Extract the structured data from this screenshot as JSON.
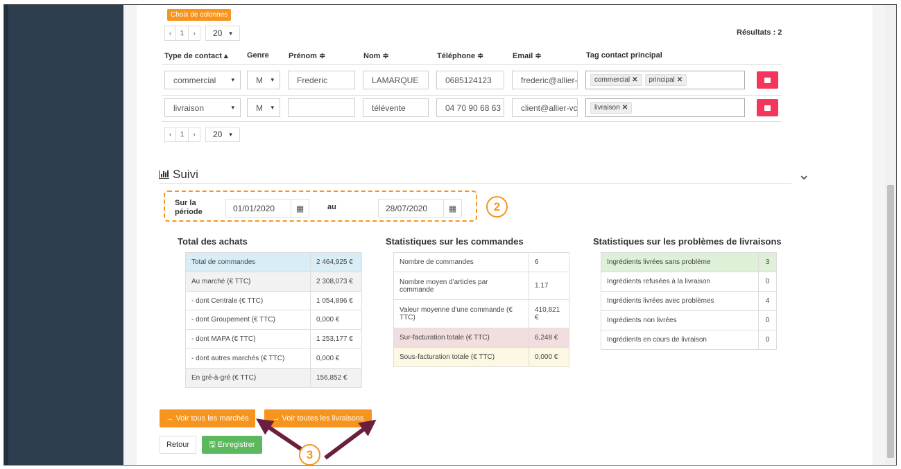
{
  "columns_button": "Choix de colonnes",
  "pager": {
    "prev": "‹",
    "page": "1",
    "next": "›",
    "page_size": "20",
    "caret": "▾"
  },
  "results": "Résultats : 2",
  "table": {
    "headers": [
      "Type de contact ▴",
      "Genre",
      "Prénom ≑",
      "Nom ≑",
      "Téléphone ≑",
      "Email ≑",
      "Tag contact principal"
    ],
    "rows": [
      {
        "type": "commercial",
        "genre": "M",
        "prenom": "Frederic",
        "nom": "LAMARQUE",
        "telephone": "0685124123",
        "email": "frederic@allier-",
        "tags": [
          "commercial",
          "principal"
        ]
      },
      {
        "type": "livraison",
        "genre": "M",
        "prenom": "",
        "nom": "télévente",
        "telephone": "04 70 90 68 63",
        "email": "client@allier-vc",
        "tags": [
          "livraison"
        ]
      }
    ]
  },
  "tag_remove": "✕",
  "suivi": {
    "title": "Suivi",
    "chevron": "⌄"
  },
  "period": {
    "label_line1": "Sur la",
    "label_line2": "période",
    "from": "01/01/2020",
    "to_label": "au",
    "to": "28/07/2020",
    "calendar": "▦"
  },
  "callouts": {
    "two": "2",
    "three": "3"
  },
  "achats": {
    "title": "Total des achats",
    "rows": [
      {
        "label": "Total de commandes",
        "value": "2 464,925 €"
      },
      {
        "label": "Au marché (€ TTC)",
        "value": "2 308,073 €"
      },
      {
        "label": "- dont Centrale (€ TTC)",
        "value": "1 054,896 €"
      },
      {
        "label": "- dont Groupement (€ TTC)",
        "value": "0,000 €"
      },
      {
        "label": "- dont MAPA (€ TTC)",
        "value": "1 253,177 €"
      },
      {
        "label": "- dont autres marchés (€ TTC)",
        "value": "0,000 €"
      },
      {
        "label": "En gré-à-gré (€ TTC)",
        "value": "156,852 €"
      }
    ]
  },
  "commandes": {
    "title": "Statistiques sur les commandes",
    "rows": [
      {
        "label": "Nombre de commandes",
        "value": "6"
      },
      {
        "label": "Nombre moyen d'articles par commande",
        "value": "1.17"
      },
      {
        "label": "Valeur moyenne d'une commande (€ TTC)",
        "value": "410,821 €"
      },
      {
        "label": "Sur-facturation totale (€ TTC)",
        "value": "6,248 €"
      },
      {
        "label": "Sous-facturation totale (€ TTC)",
        "value": "0,000 €"
      }
    ]
  },
  "livraisons": {
    "title": "Statistiques sur les problèmes de livraisons",
    "rows": [
      {
        "label": "Ingrédients livrées sans problème",
        "value": "3"
      },
      {
        "label": "Ingrédients refusées à la livraison",
        "value": "0"
      },
      {
        "label": "Ingrédients livrées avec problèmes",
        "value": "4"
      },
      {
        "label": "Ingrédients non livrées",
        "value": "0"
      },
      {
        "label": "Ingrédients en cours de livraison",
        "value": "0"
      }
    ]
  },
  "buttons": {
    "voir_marches": "→ Voir tous les marchés",
    "voir_livraisons": "→ Voir toutes les livraisons",
    "retour": "Retour",
    "enregistrer": "Enregistrer",
    "save_icon": "🖫"
  },
  "colors": {
    "accent": "#f7941d",
    "danger": "#f5365c",
    "success": "#5cb85c",
    "arrow": "#6b1f3f",
    "sidebar": "#2e3e4e"
  }
}
